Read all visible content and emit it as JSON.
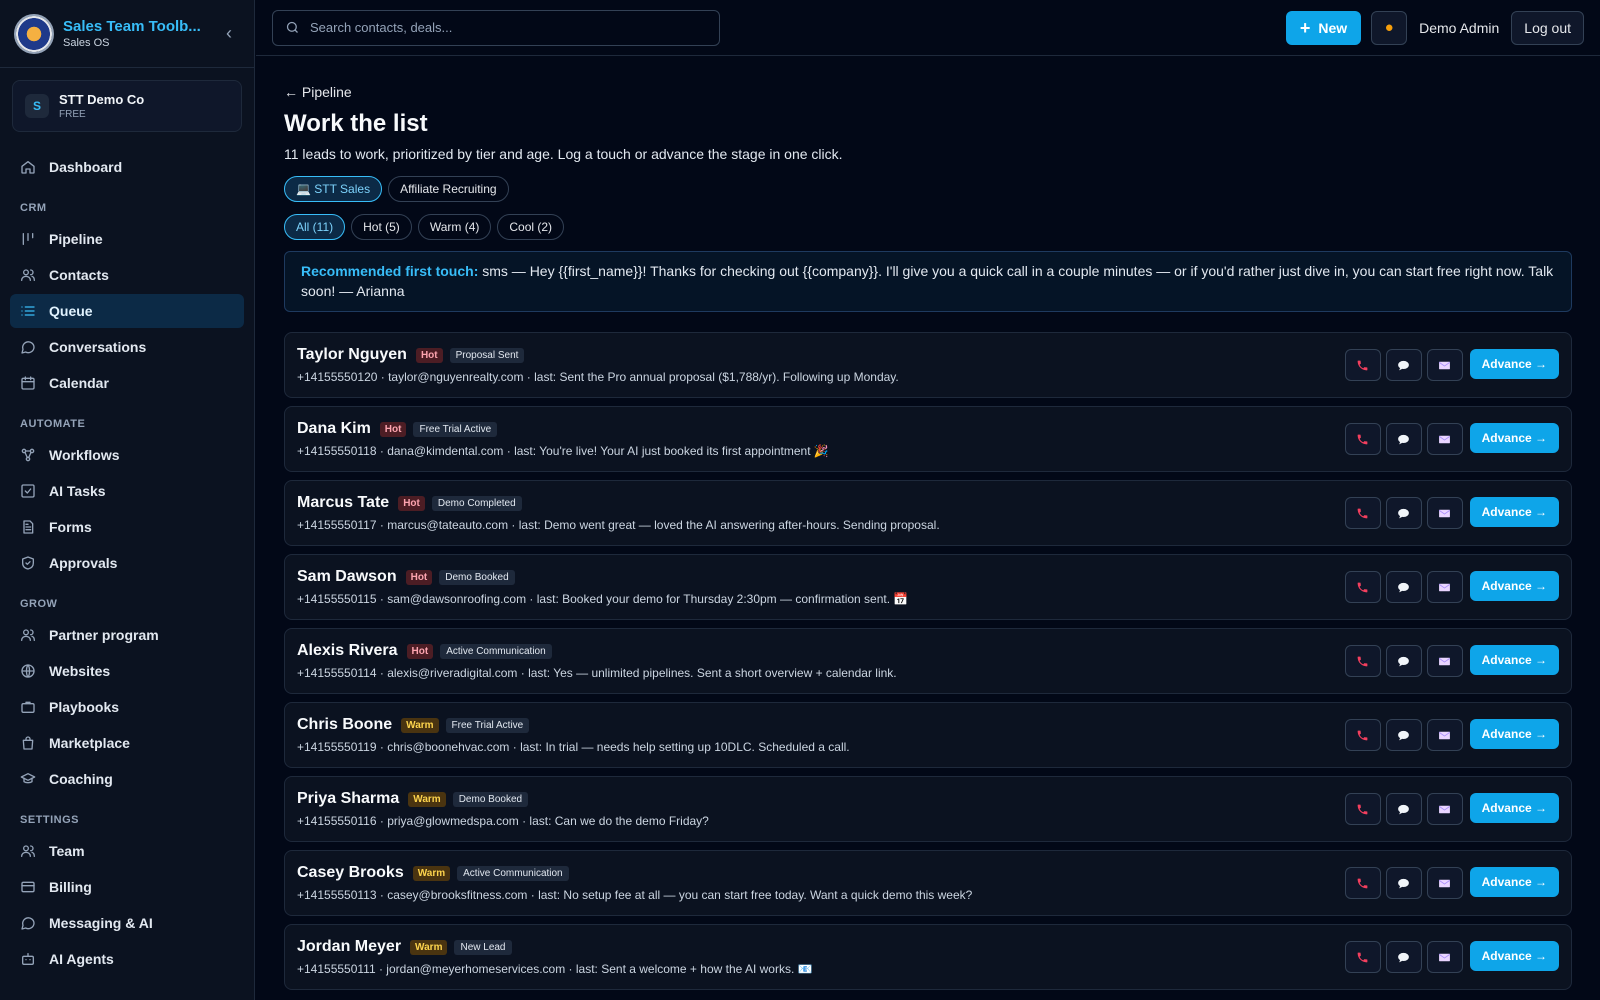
{
  "brand": {
    "title": "Sales Team Toolb...",
    "subtitle": "Sales OS"
  },
  "org": {
    "initial": "S",
    "name": "STT Demo Co",
    "plan": "FREE"
  },
  "nav": [
    {
      "type": "item",
      "name": "nav-dashboard",
      "label": "Dashboard",
      "icon": "home-icon"
    },
    {
      "type": "section",
      "label": "CRM"
    },
    {
      "type": "item",
      "name": "nav-pipeline",
      "label": "Pipeline",
      "icon": "kanban-icon"
    },
    {
      "type": "item",
      "name": "nav-contacts",
      "label": "Contacts",
      "icon": "users-icon"
    },
    {
      "type": "item",
      "name": "nav-queue",
      "label": "Queue",
      "icon": "list-icon",
      "active": true
    },
    {
      "type": "item",
      "name": "nav-conversations",
      "label": "Conversations",
      "icon": "chat-icon"
    },
    {
      "type": "item",
      "name": "nav-calendar",
      "label": "Calendar",
      "icon": "calendar-icon"
    },
    {
      "type": "section",
      "label": "AUTOMATE"
    },
    {
      "type": "item",
      "name": "nav-workflows",
      "label": "Workflows",
      "icon": "workflow-icon"
    },
    {
      "type": "item",
      "name": "nav-ai-tasks",
      "label": "AI Tasks",
      "icon": "checkbox-icon"
    },
    {
      "type": "item",
      "name": "nav-forms",
      "label": "Forms",
      "icon": "document-icon"
    },
    {
      "type": "item",
      "name": "nav-approvals",
      "label": "Approvals",
      "icon": "shield-icon"
    },
    {
      "type": "section",
      "label": "GROW"
    },
    {
      "type": "item",
      "name": "nav-partner-program",
      "label": "Partner program",
      "icon": "users-icon"
    },
    {
      "type": "item",
      "name": "nav-websites",
      "label": "Websites",
      "icon": "globe-icon"
    },
    {
      "type": "item",
      "name": "nav-playbooks",
      "label": "Playbooks",
      "icon": "briefcase-icon"
    },
    {
      "type": "item",
      "name": "nav-marketplace",
      "label": "Marketplace",
      "icon": "bag-icon"
    },
    {
      "type": "item",
      "name": "nav-coaching",
      "label": "Coaching",
      "icon": "graduation-icon"
    },
    {
      "type": "section",
      "label": "SETTINGS"
    },
    {
      "type": "item",
      "name": "nav-team",
      "label": "Team",
      "icon": "users-icon"
    },
    {
      "type": "item",
      "name": "nav-billing",
      "label": "Billing",
      "icon": "card-icon"
    },
    {
      "type": "item",
      "name": "nav-messaging-ai",
      "label": "Messaging & AI",
      "icon": "chat-icon"
    },
    {
      "type": "item",
      "name": "nav-ai-agents",
      "label": "AI Agents",
      "icon": "bot-icon"
    }
  ],
  "topbar": {
    "search_placeholder": "Search contacts, deals...",
    "new_label": "New",
    "theme_icon": "sun-icon",
    "user_name": "Demo Admin",
    "logout_label": "Log out"
  },
  "page": {
    "back_label": "← Pipeline",
    "title": "Work the list",
    "subtitle": "11 leads to work, prioritized by tier and age. Log a touch or advance the stage in one click."
  },
  "pipelines": [
    {
      "label": "💻 STT Sales",
      "active": true
    },
    {
      "label": "Affiliate Recruiting",
      "active": false
    }
  ],
  "filters": [
    {
      "label": "All (11)",
      "active": true
    },
    {
      "label": "Hot (5)",
      "active": false
    },
    {
      "label": "Warm (4)",
      "active": false
    },
    {
      "label": "Cool (2)",
      "active": false
    }
  ],
  "recommended": {
    "label": "Recommended first touch:",
    "text": "sms — Hey {{first_name}}! Thanks for checking out {{company}}. I'll give you a quick call in a couple minutes — or if you'd rather just dive in, you can start free right now. Talk soon! — Arianna"
  },
  "advance_label": "Advance →",
  "colors": {
    "accent": "#0ea5e9",
    "call_icon": "#f43f5e",
    "hot": "#fda4af",
    "warm": "#fcd34d"
  },
  "leads": [
    {
      "name": "Taylor Nguyen",
      "tier": "Hot",
      "stage": "Proposal Sent",
      "meta": "+14155550120 · taylor@nguyenrealty.com · last: Sent the Pro annual proposal ($1,788/yr). Following up Monday."
    },
    {
      "name": "Dana Kim",
      "tier": "Hot",
      "stage": "Free Trial Active",
      "meta": "+14155550118 · dana@kimdental.com · last: You're live! Your AI just booked its first appointment 🎉"
    },
    {
      "name": "Marcus Tate",
      "tier": "Hot",
      "stage": "Demo Completed",
      "meta": "+14155550117 · marcus@tateauto.com · last: Demo went great — loved the AI answering after-hours. Sending proposal."
    },
    {
      "name": "Sam Dawson",
      "tier": "Hot",
      "stage": "Demo Booked",
      "meta": "+14155550115 · sam@dawsonroofing.com · last: Booked your demo for Thursday 2:30pm — confirmation sent. 📅"
    },
    {
      "name": "Alexis Rivera",
      "tier": "Hot",
      "stage": "Active Communication",
      "meta": "+14155550114 · alexis@riveradigital.com · last: Yes — unlimited pipelines. Sent a short overview + calendar link."
    },
    {
      "name": "Chris Boone",
      "tier": "Warm",
      "stage": "Free Trial Active",
      "meta": "+14155550119 · chris@boonehvac.com · last: In trial — needs help setting up 10DLC. Scheduled a call."
    },
    {
      "name": "Priya Sharma",
      "tier": "Warm",
      "stage": "Demo Booked",
      "meta": "+14155550116 · priya@glowmedspa.com · last: Can we do the demo Friday?"
    },
    {
      "name": "Casey Brooks",
      "tier": "Warm",
      "stage": "Active Communication",
      "meta": "+14155550113 · casey@brooksfitness.com · last: No setup fee at all — you can start free today. Want a quick demo this week?"
    },
    {
      "name": "Jordan Meyer",
      "tier": "Warm",
      "stage": "New Lead",
      "meta": "+14155550111 · jordan@meyerhomeservices.com · last: Sent a welcome + how the AI works. 📧"
    }
  ]
}
